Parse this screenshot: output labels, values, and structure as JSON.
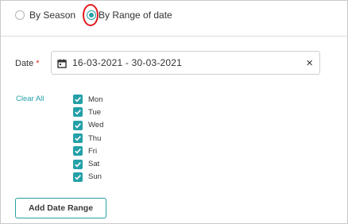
{
  "range_type": {
    "options": [
      {
        "label": "By Season",
        "selected": false
      },
      {
        "label": "By Range of date",
        "selected": true
      }
    ]
  },
  "date_field": {
    "label": "Date",
    "required_mark": "*",
    "value": "16-03-2021 - 30-03-2021",
    "clear_icon": "×",
    "calendar_icon": "calendar-icon"
  },
  "days": {
    "clear_all_label": "Clear All",
    "items": [
      {
        "label": "Mon",
        "checked": true
      },
      {
        "label": "Tue",
        "checked": true
      },
      {
        "label": "Wed",
        "checked": true
      },
      {
        "label": "Thu",
        "checked": true
      },
      {
        "label": "Fri",
        "checked": true
      },
      {
        "label": "Sat",
        "checked": true
      },
      {
        "label": "Sun",
        "checked": true
      }
    ]
  },
  "add_button_label": "Add Date Range",
  "colors": {
    "accent": "#24a0a8",
    "highlight_ring": "#e0191e",
    "required": "#d93025"
  }
}
